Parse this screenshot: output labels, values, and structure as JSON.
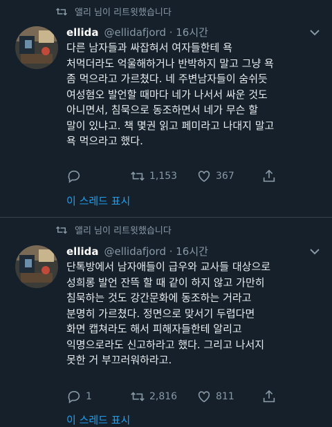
{
  "tweets": [
    {
      "retweet_label": "앨리 님이 리트윗했습니다",
      "display_name": "ellida",
      "handle_time": "@ellidafjord · 16시간",
      "text": "다른 남자들과 싸잡혀서 여자들한테 욕\n처먹더라도 억울해하거나 반박하지 말고 그냥 욕\n좀 먹으라고 가르쳤다. 네 주변남자들이 숨쉬듯\n여성혐오 발언할 때마다 네가 나서서 싸운 것도\n아니면서, 침묵으로 동조하면서 네가 무슨 할\n말이 있냐고. 책 몇권 읽고 페미라고 나대지 말고\n욕 먹으라고 했다.",
      "reply_count": "",
      "retweet_count": "1,153",
      "like_count": "367",
      "thread_link": "이 스레드 표시"
    },
    {
      "retweet_label": "앨리 님이 리트윗했습니다",
      "display_name": "ellida",
      "handle_time": "@ellidafjord · 16시간",
      "text": "단톡방에서 남자애들이 급우와 교사들 대상으로\n성희롱 발언 잔뜩 할 때 같이 하지 않고 가만히\n침묵하는 것도 강간문화에 동조하는 거라고\n분명히 가르쳤다. 정면으로 맞서기 두렵다면\n화면 캡쳐라도 해서 피해자들한테 알리고\n익명으로라도 신고하라고 했다. 그리고 나서지\n못한 거 부끄러워하라고.",
      "reply_count": "1",
      "retweet_count": "2,816",
      "like_count": "811",
      "thread_link": "이 스레드 표시"
    }
  ],
  "colors": {
    "background": "#15202b",
    "muted": "#8899a6",
    "link": "#1da1f2",
    "divider": "#38444d"
  },
  "icons": [
    "retweet-icon",
    "reply-icon",
    "like-icon",
    "share-icon",
    "chevron-down-icon"
  ]
}
